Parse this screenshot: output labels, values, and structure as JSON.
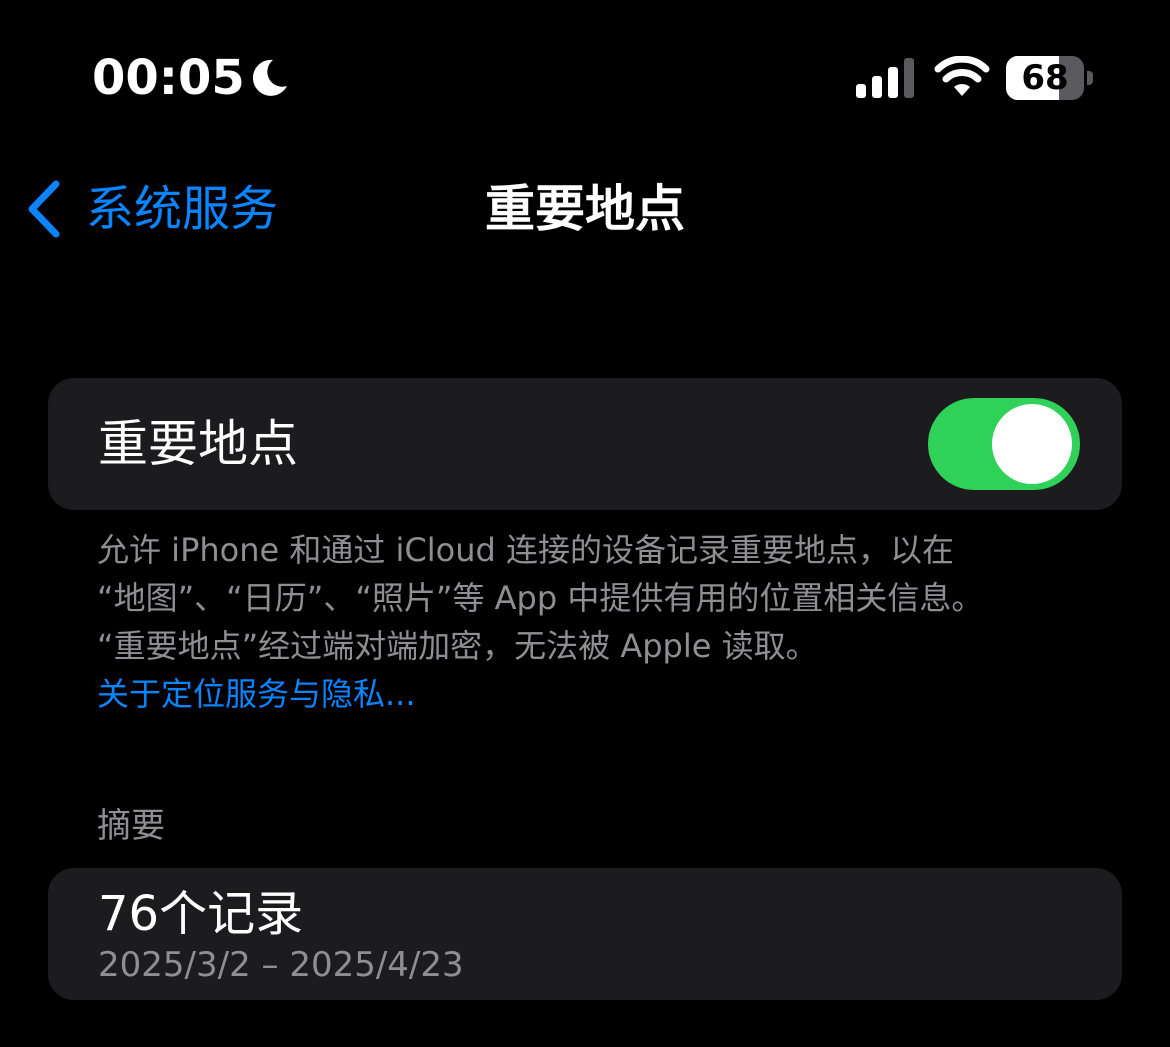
{
  "status_bar": {
    "time": "00:05",
    "battery_level": 68,
    "battery_text": "68",
    "icons": [
      "moon-icon",
      "signal-icon",
      "wifi-icon",
      "battery-icon"
    ]
  },
  "nav": {
    "back_label": "系统服务",
    "title": "重要地点"
  },
  "toggle_row": {
    "label": "重要地点",
    "enabled": true
  },
  "footnote": {
    "lines": [
      "允许 iPhone 和通过 iCloud 连接的设备记录重要地点，以在",
      "“地图”、“日历”、“照片”等 App 中提供有用的位置相关信息。",
      "“重要地点”经过端对端加密，无法被 Apple 读取。"
    ],
    "link": "关于定位服务与隐私..."
  },
  "summary": {
    "header": "摘要",
    "title": "76个记录",
    "date_range": "2025/3/2 – 2025/4/23"
  },
  "colors": {
    "background": "#000000",
    "card": "#1c1c1e",
    "accent_blue": "#0a84ff",
    "toggle_on": "#30d158",
    "secondary_text": "#8e8e93"
  }
}
